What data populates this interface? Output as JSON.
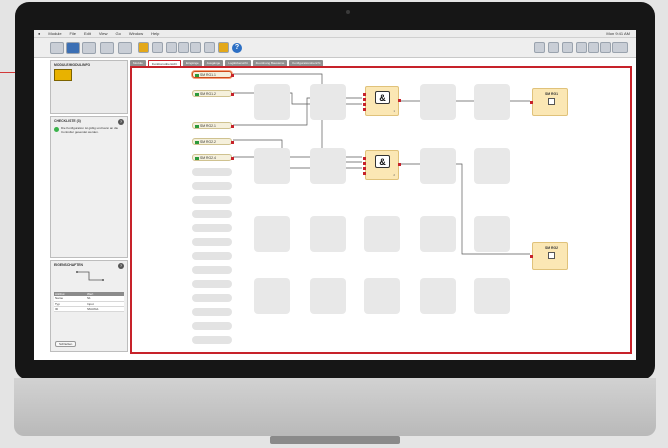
{
  "menubar": {
    "items": [
      "Module",
      "File",
      "Edit",
      "View",
      "Go",
      "Window",
      "Help"
    ],
    "status_right": "Mon 9:41 AM"
  },
  "left_pane": {
    "title": "MODULE/MODULINFO"
  },
  "status_panel": {
    "title": "CHECKLISTE (3)",
    "message": "Die Konfiguration ist gültig und kann an die Controller gesendet werden."
  },
  "properties_panel": {
    "title": "EIGENSCHAFTEN",
    "headers": [
      "Attribut",
      "Wert"
    ],
    "rows": [
      [
        "Name",
        "S1"
      ],
      [
        "Typ",
        "Input"
      ],
      [
        "ID",
        "SM-RG1"
      ]
    ],
    "button_label": "Schließen"
  },
  "tabs": [
    "Module",
    "Funktionsübersicht",
    "Eingänge",
    "Ausgänge",
    "Logikübersicht",
    "Zuordnung Bausteine",
    "Konfigurationsbericht"
  ],
  "active_tab_index": 1,
  "logic": {
    "inputs": [
      {
        "label": "SM RG1.1",
        "selected": true
      },
      {
        "label": "SM RG1.2",
        "selected": false
      },
      {
        "label": "SM RG2.1",
        "selected": false
      },
      {
        "label": "SM RG2.2",
        "selected": false
      },
      {
        "label": "SM RG2.4",
        "selected": false
      }
    ],
    "gates": [
      {
        "symbol": "&",
        "label": "1"
      },
      {
        "symbol": "&",
        "label": "2"
      }
    ],
    "outputs": [
      {
        "label": "SM RG1"
      },
      {
        "label": "SM RG2"
      }
    ]
  },
  "colors": {
    "accent": "#c7222a",
    "block_fill": "#fbe7b4",
    "status_ok": "#3ab34a"
  }
}
